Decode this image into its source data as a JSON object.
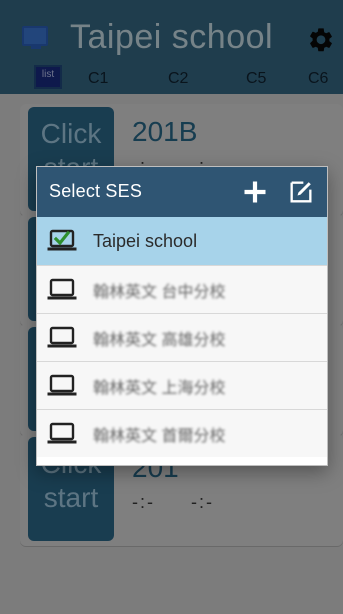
{
  "app": {
    "title": "Taipei school",
    "tabs": [
      {
        "label": "list"
      },
      {
        "label": "C1"
      },
      {
        "label": "C2"
      },
      {
        "label": "C5"
      },
      {
        "label": "C6"
      }
    ],
    "cards": [
      {
        "button_label_line1": "Click",
        "button_label_line2": "start",
        "room": "201B",
        "time_1": "-:-",
        "time_2": "-:-"
      },
      {
        "button_label_line1": "",
        "button_label_line2": "",
        "room": "",
        "time_1": "",
        "time_2": ""
      },
      {
        "button_label_line1": "",
        "button_label_line2": "",
        "room": "",
        "time_1": "",
        "time_2": ""
      },
      {
        "button_label_line1": "Click",
        "button_label_line2": "start",
        "room": "201",
        "time_1": "-:-",
        "time_2": "-:-"
      }
    ],
    "colors": {
      "header": "#3a6f8d",
      "accent": "#2f6f93"
    }
  },
  "dialog": {
    "title": "Select SES",
    "actions": [
      {
        "name": "plus-icon"
      },
      {
        "name": "edit-icon"
      }
    ],
    "items": [
      {
        "label": "Taipei school",
        "icon": "laptop-check-icon",
        "selected": true
      },
      {
        "label": "翰林英文 台中分校",
        "icon": "laptop-icon",
        "selected": false
      },
      {
        "label": "翰林英文 高雄分校",
        "icon": "laptop-icon",
        "selected": false
      },
      {
        "label": "翰林英文 上海分校",
        "icon": "laptop-icon",
        "selected": false
      },
      {
        "label": "翰林英文 首爾分校",
        "icon": "laptop-icon",
        "selected": false
      }
    ],
    "colors": {
      "header": "#2f5573",
      "selected_row": "#a7d3ea",
      "check": "#2f8f2f"
    }
  }
}
